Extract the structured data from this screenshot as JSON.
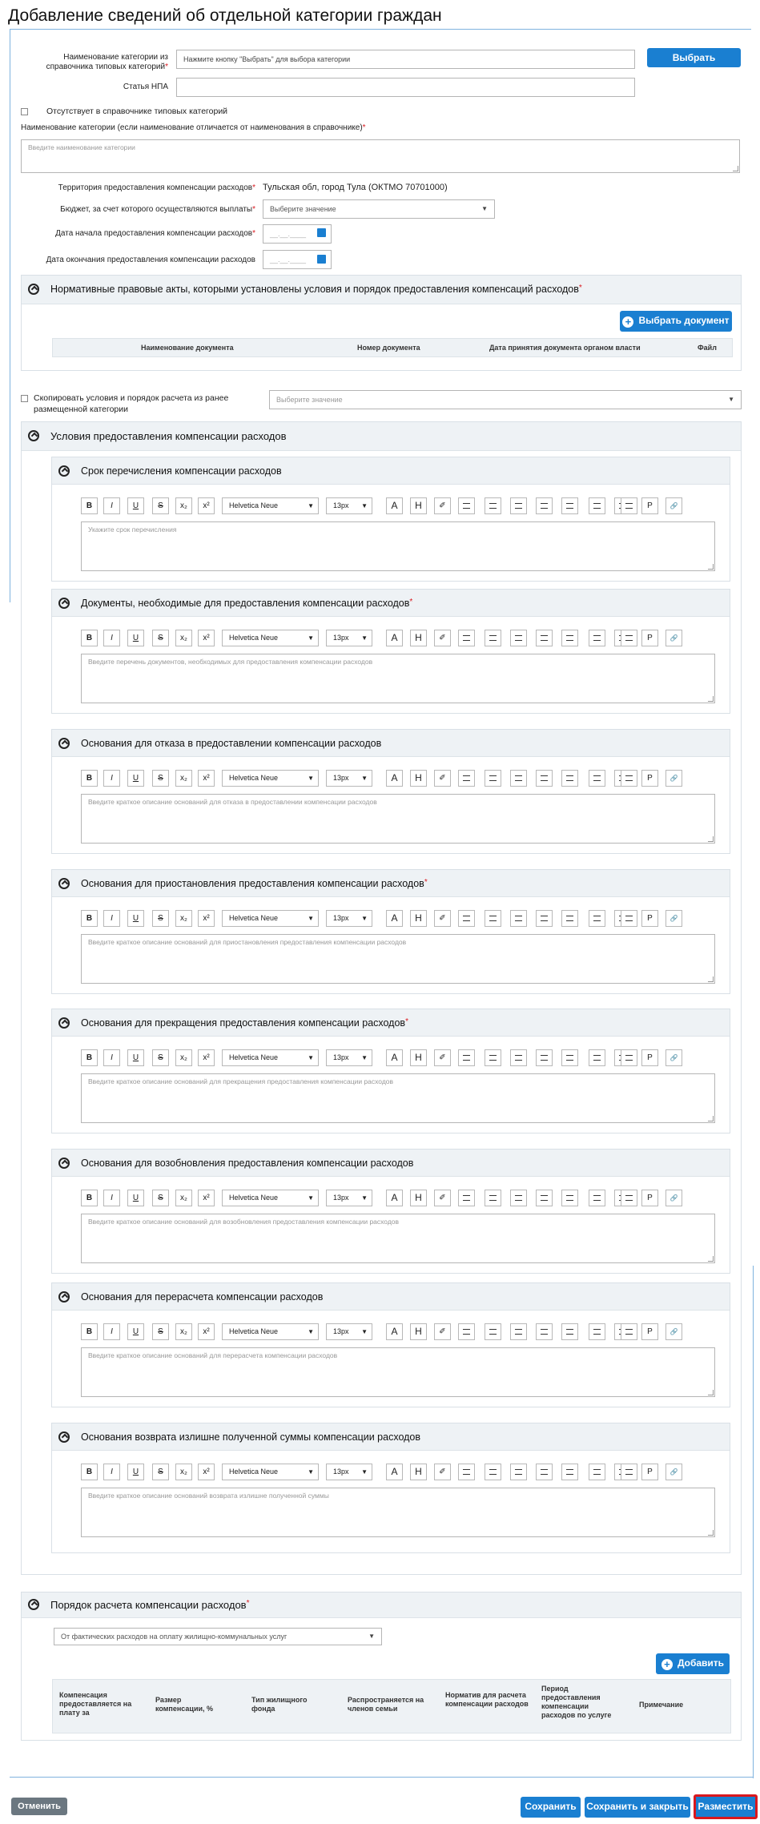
{
  "page": {
    "title": "Добавление сведений об отдельной категории граждан"
  },
  "colors": {
    "accent": "#1a7fd1",
    "required": "#d9181e",
    "cancel": "#6b7780",
    "highlight_border": "#d9181e"
  },
  "form": {
    "category_label": "Наименование категории из справочника типовых категорий",
    "category_placeholder": "Нажмите кнопку \"Выбрать\" для выбора категории",
    "choose_label": "Выбрать",
    "npa_label": "Статья НПА",
    "npa_value": "",
    "missing_label": "Отсутствует в справочнике типовых категорий",
    "name_label": "Наименование категории (если наименование отличается от наименования в справочнике)",
    "name_placeholder": "Введите наименование категории",
    "territory_label": "Территория предоставления компенсации расходов",
    "territory_value": "Тульская обл, город Тула (ОКТМО 70701000)",
    "budget_label": "Бюджет, за счет которого осуществляются выплаты",
    "budget_placeholder": "Выберите значение",
    "start_label": "Дата начала предоставления компенсации расходов",
    "end_label": "Дата окончания предоставления компенсации расходов",
    "date_placeholder": "__.__.____",
    "required_mark": "*"
  },
  "acts": {
    "title": "Нормативные правовые акты, которыми установлены условия и порядок предоставления компенсаций расходов",
    "choose_doc": "Выбрать документ",
    "columns": [
      "Наименование документа",
      "Номер документа",
      "Дата принятия документа органом власти",
      "Файл"
    ]
  },
  "copy": {
    "label": "Скопировать условия и порядок расчета из ранее размещенной категории",
    "placeholder": "Выберите значение"
  },
  "conditions": {
    "title": "Условия предоставления компенсации расходов",
    "toolbar": {
      "bold": "B",
      "italic": "I",
      "underline": "U",
      "strike": "S",
      "sub": "x₂",
      "sup": "x²",
      "font": "Helvetica Neue",
      "size": "13px",
      "color": "A",
      "highlight": "H",
      "eraser": "✐",
      "p": "P",
      "link": "🔗"
    },
    "sections": [
      {
        "title": "Срок перечисления компенсации расходов",
        "req": "",
        "placeholder": "Укажите срок перечисления"
      },
      {
        "title": "Документы, необходимые для предоставления компенсации расходов",
        "req": "*",
        "placeholder": "Введите перечень документов, необходимых для предоставления компенсации расходов"
      },
      {
        "title": "Основания для отказа в предоставлении компенсации расходов",
        "req": "",
        "placeholder": "Введите краткое описание оснований для отказа в предоставлении компенсации расходов"
      },
      {
        "title": "Основания для приостановления предоставления компенсации расходов",
        "req": "*",
        "placeholder": "Введите краткое описание оснований для приостановления предоставления компенсации расходов"
      },
      {
        "title": "Основания для прекращения предоставления компенсации расходов",
        "req": "*",
        "placeholder": "Введите краткое описание оснований для прекращения предоставления компенсации расходов"
      },
      {
        "title": "Основания для возобновления предоставления компенсации расходов",
        "req": "",
        "placeholder": "Введите краткое описание оснований для возобновления предоставления компенсации расходов"
      },
      {
        "title": "Основания для перерасчета компенсации расходов",
        "req": "",
        "placeholder": "Введите краткое описание оснований для перерасчета компенсации расходов"
      },
      {
        "title": "Основания возврата излишне полученной суммы компенсации расходов",
        "req": "",
        "placeholder": "Введите краткое описание оснований возврата излишне полученной суммы"
      }
    ]
  },
  "calc": {
    "title": "Порядок расчета компенсации расходов",
    "select_value": "От фактических расходов на оплату жилищно-коммунальных услуг",
    "add_label": "Добавить",
    "columns": [
      "Компенсация предоставляется на плату за",
      "Размер компенсации, %",
      "Тип жилищного фонда",
      "Распространяется на членов семьи",
      "Норматив для расчета компенсации расходов",
      "Период предоставления компенсации расходов по услуге",
      "Примечание"
    ]
  },
  "footer": {
    "cancel": "Отменить",
    "save": "Сохранить",
    "save_close": "Сохранить и закрыть",
    "publish": "Разместить"
  }
}
